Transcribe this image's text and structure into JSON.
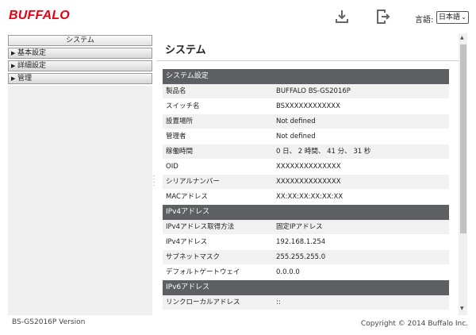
{
  "header": {
    "logo": "BUFFALO",
    "lang_label": "言語:",
    "lang_value": "日本語",
    "icons": [
      "download-icon",
      "logout-icon"
    ]
  },
  "sidebar": {
    "items": [
      {
        "label": "システム",
        "active": true
      },
      {
        "label": "基本設定",
        "active": false
      },
      {
        "label": "詳細設定",
        "active": false
      },
      {
        "label": "管理",
        "active": false
      }
    ]
  },
  "main": {
    "title": "システム",
    "sections": [
      {
        "header": "システム設定",
        "rows": [
          {
            "key": "製品名",
            "value": "BUFFALO BS-GS2016P"
          },
          {
            "key": "スイッチ名",
            "value": "BSXXXXXXXXXXXX"
          },
          {
            "key": "設置場所",
            "value": "Not defined"
          },
          {
            "key": "管理者",
            "value": "Not defined"
          },
          {
            "key": "稼働時間",
            "value": "0 日、 2 時間、 41 分、 31 秒"
          },
          {
            "key": "OID",
            "value": "XXXXXXXXXXXXXX"
          },
          {
            "key": "シリアルナンバー",
            "value": "XXXXXXXXXXXXXX"
          },
          {
            "key": "MACアドレス",
            "value": "XX:XX:XX:XX:XX:XX"
          }
        ]
      },
      {
        "header": "IPv4アドレス",
        "rows": [
          {
            "key": "IPv4アドレス取得方法",
            "value": "固定IPアドレス"
          },
          {
            "key": "IPv4アドレス",
            "value": "192.168.1.254"
          },
          {
            "key": "サブネットマスク",
            "value": "255.255.255.0"
          },
          {
            "key": "デフォルトゲートウェイ",
            "value": "0.0.0.0"
          }
        ]
      },
      {
        "header": "IPv6アドレス",
        "rows": [
          {
            "key": "リンクローカルアドレス",
            "value": "::"
          }
        ]
      }
    ]
  },
  "footer": {
    "version": "BS-GS2016P Version",
    "copyright": "Copyright © 2014 Buffalo Inc."
  }
}
